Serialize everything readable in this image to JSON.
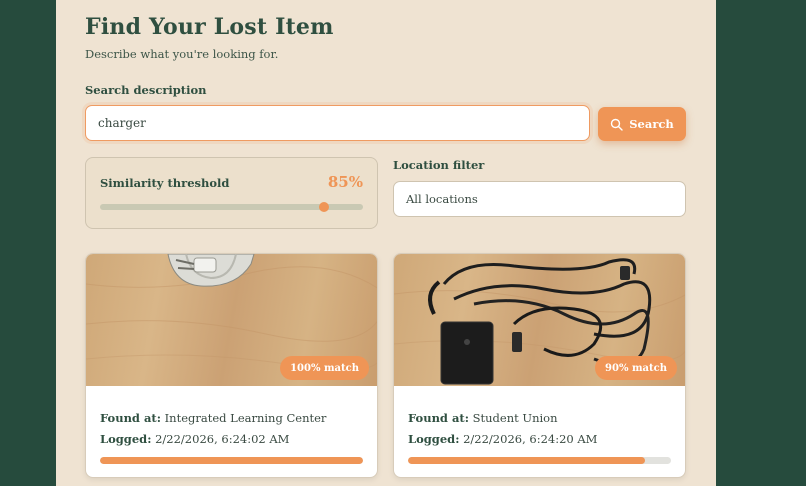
{
  "page": {
    "title": "Find Your Lost Item",
    "subtitle": "Describe what you're looking for."
  },
  "search": {
    "label": "Search description",
    "value": "charger",
    "button_label": "Search",
    "button_icon": "search-icon"
  },
  "threshold": {
    "label": "Similarity threshold",
    "value_text": "85%",
    "value": 0.85
  },
  "location": {
    "label": "Location filter",
    "selected": "All locations"
  },
  "results": [
    {
      "match_text": "100% match",
      "match": 1.0,
      "found_label": "Found at:",
      "found_at": "Integrated Learning Center",
      "logged_label": "Logged:",
      "logged": "2/22/2026, 6:24:02 AM"
    },
    {
      "match_text": "90% match",
      "match": 0.9,
      "found_label": "Found at:",
      "found_at": "Student Union",
      "logged_label": "Logged:",
      "logged": "2/22/2026, 6:24:20 AM"
    }
  ],
  "colors": {
    "background": "#264b3d",
    "panel": "#efe3d2",
    "accent": "#ef9556",
    "heading": "#2f4f40"
  }
}
